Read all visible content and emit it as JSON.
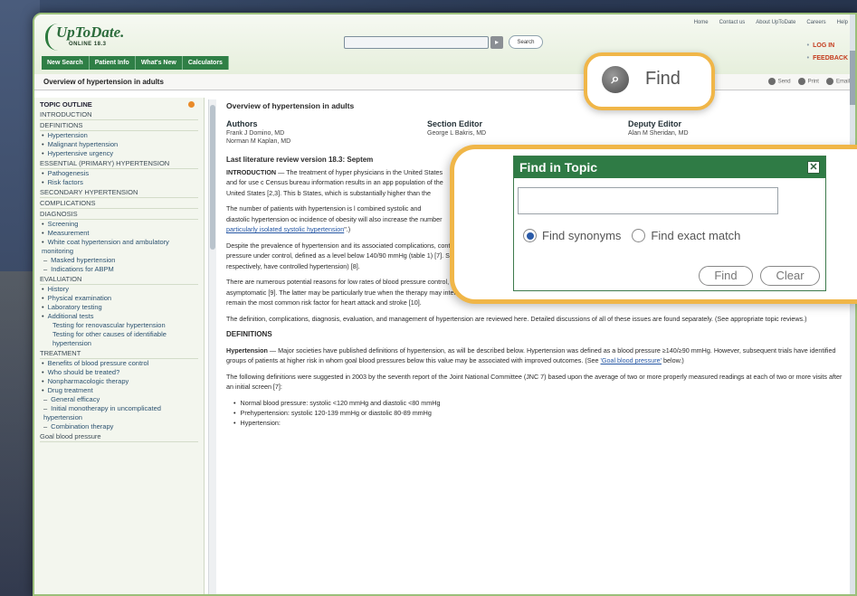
{
  "header": {
    "logo_main": "UpToDate.",
    "logo_sub": "ONLINE 18.3",
    "search_button": "Search",
    "search_go": "▸",
    "toplinks": [
      "Home",
      "Contact us",
      "About UpToDate",
      "Careers",
      "Help"
    ],
    "rightlinks": [
      "LOG IN",
      "FEEDBACK"
    ],
    "nav": [
      "New Search",
      "Patient Info",
      "What's New",
      "Calculators"
    ]
  },
  "titlebar": {
    "title": "Overview of hypertension in adults",
    "tools": [
      "Send",
      "Print",
      "Email"
    ]
  },
  "find_callout": {
    "label": "Find"
  },
  "popup": {
    "title": "Find in Topic",
    "close": "✕",
    "option1": "Find synonyms",
    "option2": "Find exact match",
    "find_btn": "Find",
    "clear_btn": "Clear"
  },
  "sidebar": {
    "head": "TOPIC OUTLINE",
    "rows": [
      {
        "t": "sec",
        "v": "INTRODUCTION"
      },
      {
        "t": "sec",
        "v": "DEFINITIONS"
      },
      {
        "t": "item",
        "v": "Hypertension"
      },
      {
        "t": "item",
        "v": "Malignant hypertension"
      },
      {
        "t": "item",
        "v": "Hypertensive urgency"
      },
      {
        "t": "sec",
        "v": "ESSENTIAL (PRIMARY) HYPERTENSION"
      },
      {
        "t": "item",
        "v": "Pathogenesis"
      },
      {
        "t": "item",
        "v": "Risk factors"
      },
      {
        "t": "sec",
        "v": "SECONDARY HYPERTENSION"
      },
      {
        "t": "sec",
        "v": "COMPLICATIONS"
      },
      {
        "t": "sec",
        "v": "DIAGNOSIS"
      },
      {
        "t": "item",
        "v": "Screening"
      },
      {
        "t": "item",
        "v": "Measurement"
      },
      {
        "t": "item",
        "v": "White coat hypertension and ambulatory monitoring"
      },
      {
        "t": "sub",
        "v": "Masked hypertension"
      },
      {
        "t": "sub",
        "v": "Indications for ABPM"
      },
      {
        "t": "sec",
        "v": "EVALUATION"
      },
      {
        "t": "item",
        "v": "History"
      },
      {
        "t": "item",
        "v": "Physical examination"
      },
      {
        "t": "item",
        "v": "Laboratory testing"
      },
      {
        "t": "item",
        "v": "Additional tests"
      },
      {
        "t": "subsub",
        "v": "Testing for renovascular hypertension"
      },
      {
        "t": "subsub",
        "v": "Testing for other causes of identifiable hypertension"
      },
      {
        "t": "sec",
        "v": "TREATMENT"
      },
      {
        "t": "item",
        "v": "Benefits of blood pressure control"
      },
      {
        "t": "item",
        "v": "Who should be treated?"
      },
      {
        "t": "item",
        "v": "Nonpharmacologic therapy"
      },
      {
        "t": "item",
        "v": "Drug treatment"
      },
      {
        "t": "sub",
        "v": "General efficacy"
      },
      {
        "t": "sub",
        "v": "Initial monotherapy in uncomplicated hypertension"
      },
      {
        "t": "sub",
        "v": "Combination therapy"
      },
      {
        "t": "sec2",
        "v": "Goal blood pressure"
      }
    ]
  },
  "content": {
    "title": "Overview of hypertension in adults",
    "authors_head": "Authors",
    "authors": [
      "Frank J Domino, MD",
      "Norman M Kaplan, MD"
    ],
    "section_editor_head": "Section Editor",
    "section_editor": "George L Bakris, MD",
    "deputy_editor_head": "Deputy Editor",
    "deputy_editor": "Alan M Sheridan, MD",
    "review": "Last literature review version 18.3: Septem",
    "intro_lead": "INTRODUCTION",
    "intro_text": " — The treatment of hyper physicians in the United States and for use c Census bureau information results in an app population of the United States [2,3]. This b States, which is substantially higher than the",
    "p2": "The number of patients with hypertension is l combined systolic and diastolic hypertension oc incidence of obesity will also increase the number",
    "p2_link": "particularly isolated systolic hypertension",
    "p2_end": "\".)",
    "p3": "Despite the prevalence of hypertension and its associated complications, control of the disease is far from adequate [4-6]. Data from NHANES show that only 34 percent of persons with hypertension have their blood pressure under control, defined as a level below 140/90 mmHg (table 1) [7]. Slightly higher rates of control were reported in a regional population study (approximately 45 and 55 percent of men and women, respectively, have controlled hypertension) [8].",
    "p4": "There are numerous potential reasons for low rates of blood pressure control, including poor access to health care and medications, and lack of adherence with long-term therapy for a condition that is usually asymptomatic [9]. The latter may be particularly true when the therapy may interfere with the patient's quality of life and when its immediate benefits may not be obvious to the patient. Thus, hypertension will likely remain the most common risk factor for heart attack and stroke [10].",
    "p5": "The definition, complications, diagnosis, evaluation, and management of hypertension are reviewed here. Detailed discussions of all of these issues are found separately. (See appropriate topic reviews.)",
    "def_head": "DEFINITIONS",
    "def_lead": "Hypertension",
    "def_text": " — Major societies have published definitions of hypertension, as will be described below. Hypertension was defined as a blood pressure ≥140/≥90 mmHg. However, subsequent trials have identified groups of patients at higher risk in whom goal blood pressures below this value may be associated with improved outcomes. (See ",
    "def_link": "'Goal blood pressure'",
    "def_end": " below.)",
    "p7": "The following definitions were suggested in 2003 by the seventh report of the Joint National Committee (JNC 7) based upon the average of two or more properly measured readings at each of two or more visits after an initial screen [7]:",
    "bullets": [
      "Normal blood pressure: systolic <120 mmHg and diastolic <80 mmHg",
      "Prehypertension: systolic 120-139 mmHg or diastolic 80-89 mmHg",
      "Hypertension:"
    ]
  }
}
